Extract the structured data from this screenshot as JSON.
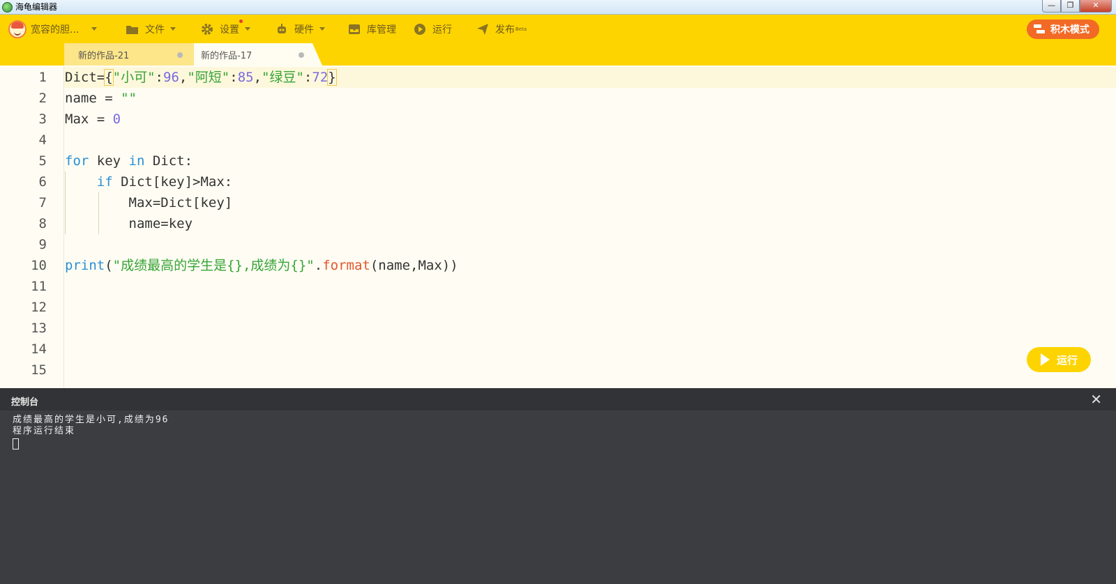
{
  "window": {
    "title": "海龟编辑器",
    "controls": [
      "—",
      "❐",
      "✕"
    ]
  },
  "toolbar": {
    "user_name": "宽容的胆...",
    "items": [
      {
        "label": "文件",
        "icon": "folder-icon"
      },
      {
        "label": "设置",
        "icon": "gear-icon"
      },
      {
        "label": "硬件",
        "icon": "robot-icon"
      },
      {
        "label": "库管理",
        "icon": "inbox-icon"
      },
      {
        "label": "运行",
        "icon": "play-circle-icon"
      },
      {
        "label": "发布",
        "icon": "send-icon",
        "badge": "Beta"
      }
    ],
    "mode_button": "积木模式"
  },
  "tabs": [
    {
      "label": "新的作品-21",
      "active": false
    },
    {
      "label": "新的作品-17",
      "active": true
    }
  ],
  "editor": {
    "line_numbers": [
      "1",
      "2",
      "3",
      "4",
      "5",
      "6",
      "7",
      "8",
      "9",
      "10",
      "11",
      "12",
      "13",
      "14",
      "15"
    ],
    "run_button": "运行"
  },
  "console": {
    "title": "控制台",
    "close": "✕",
    "lines": [
      "成绩最高的学生是小可,成绩为96",
      "程序运行结束"
    ]
  },
  "colors": {
    "toolbar": "#fed400",
    "accent": "#f26a26",
    "keyword": "#2b8fd6",
    "string": "#36a336",
    "number": "#7a6ae0",
    "method": "#e4552a",
    "console_bg": "#3c3d41"
  }
}
